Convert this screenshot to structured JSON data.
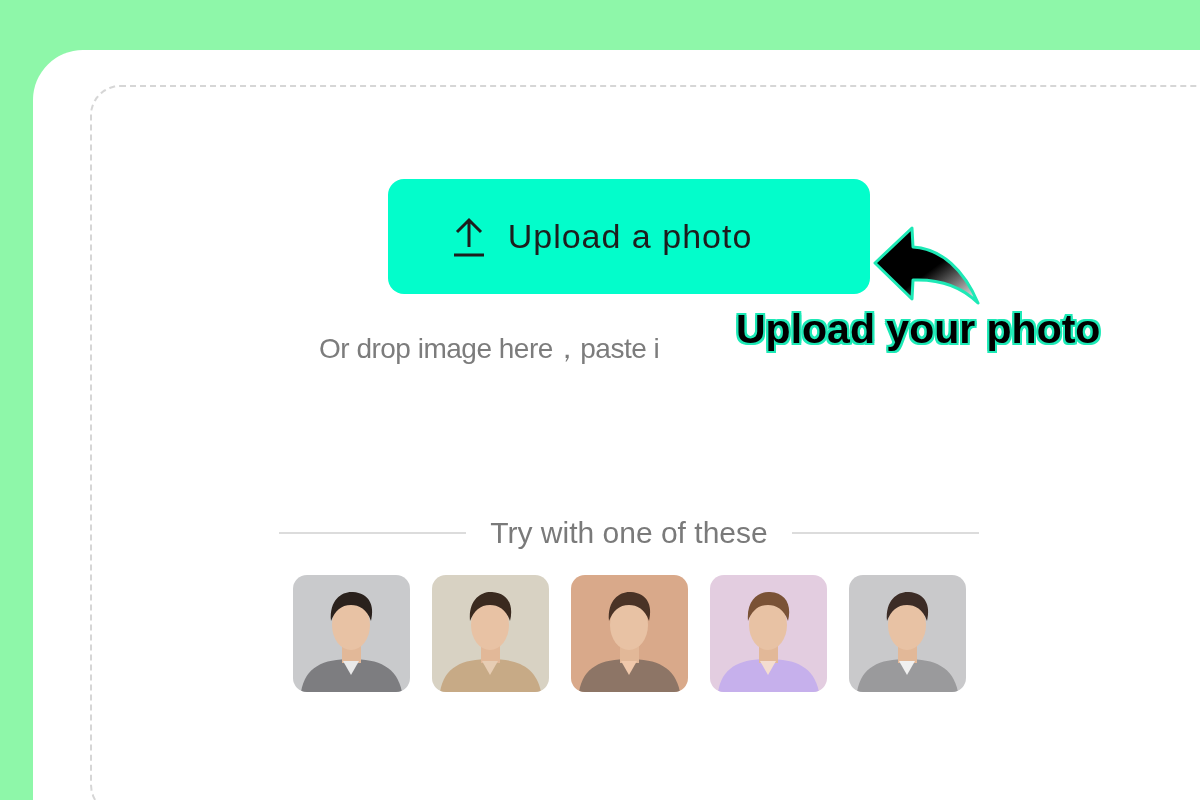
{
  "upload_button": {
    "label": "Upload a photo"
  },
  "drop_hint": "Or drop image here，paste i",
  "annotation": {
    "text": "Upload your photo"
  },
  "samples": {
    "heading": "Try with one of these"
  }
}
